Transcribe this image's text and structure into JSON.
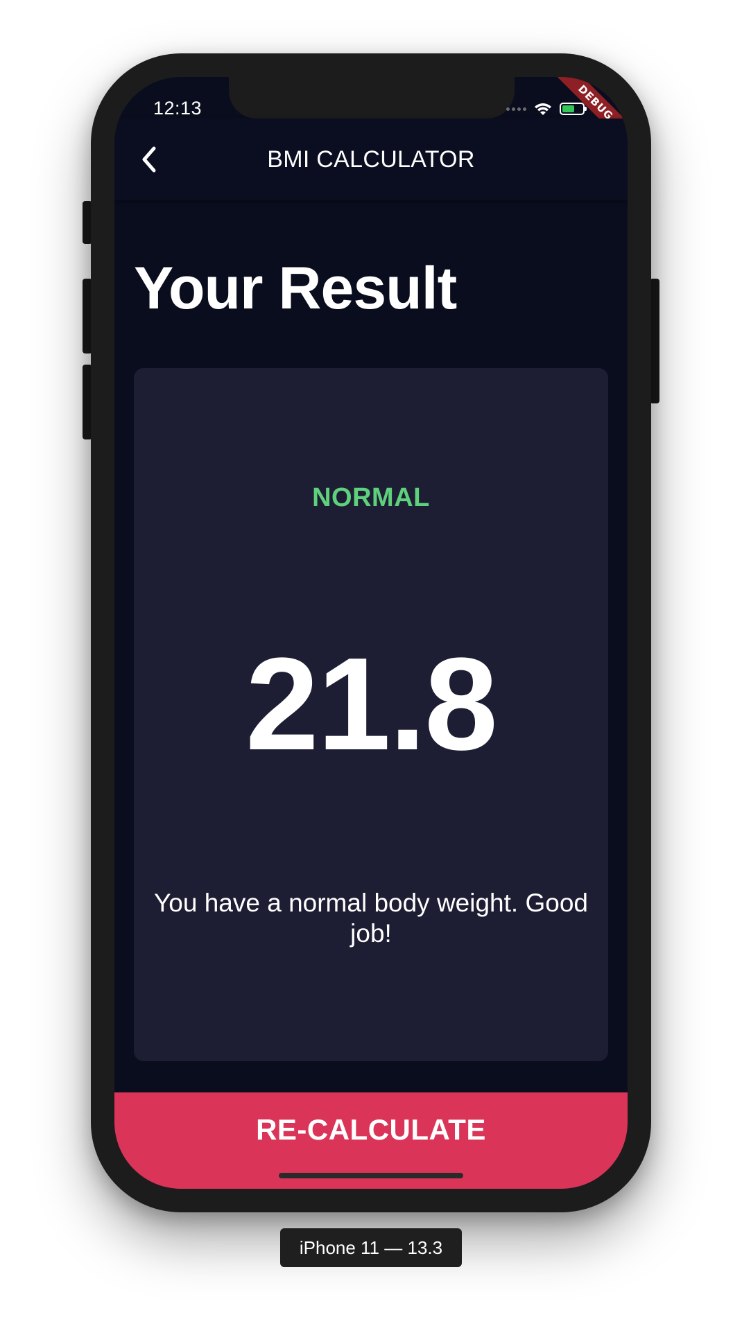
{
  "status_bar": {
    "time": "12:13",
    "debug_banner": "DEBUG",
    "battery_level": 0.6
  },
  "app_bar": {
    "title": "BMI CALCULATOR",
    "back_icon": "chevron-left-icon"
  },
  "page": {
    "title": "Your Result"
  },
  "result_card": {
    "status": "NORMAL",
    "bmi": "21.8",
    "interpretation": "You have a normal body weight. Good job!"
  },
  "bottom_button": {
    "label": "RE-CALCULATE"
  },
  "device_caption": "iPhone 11 — 13.3",
  "colors": {
    "background": "#0a0d1e",
    "card": "#1d1e33",
    "status_green": "#5fd17d",
    "accent_pink": "#da3558"
  }
}
